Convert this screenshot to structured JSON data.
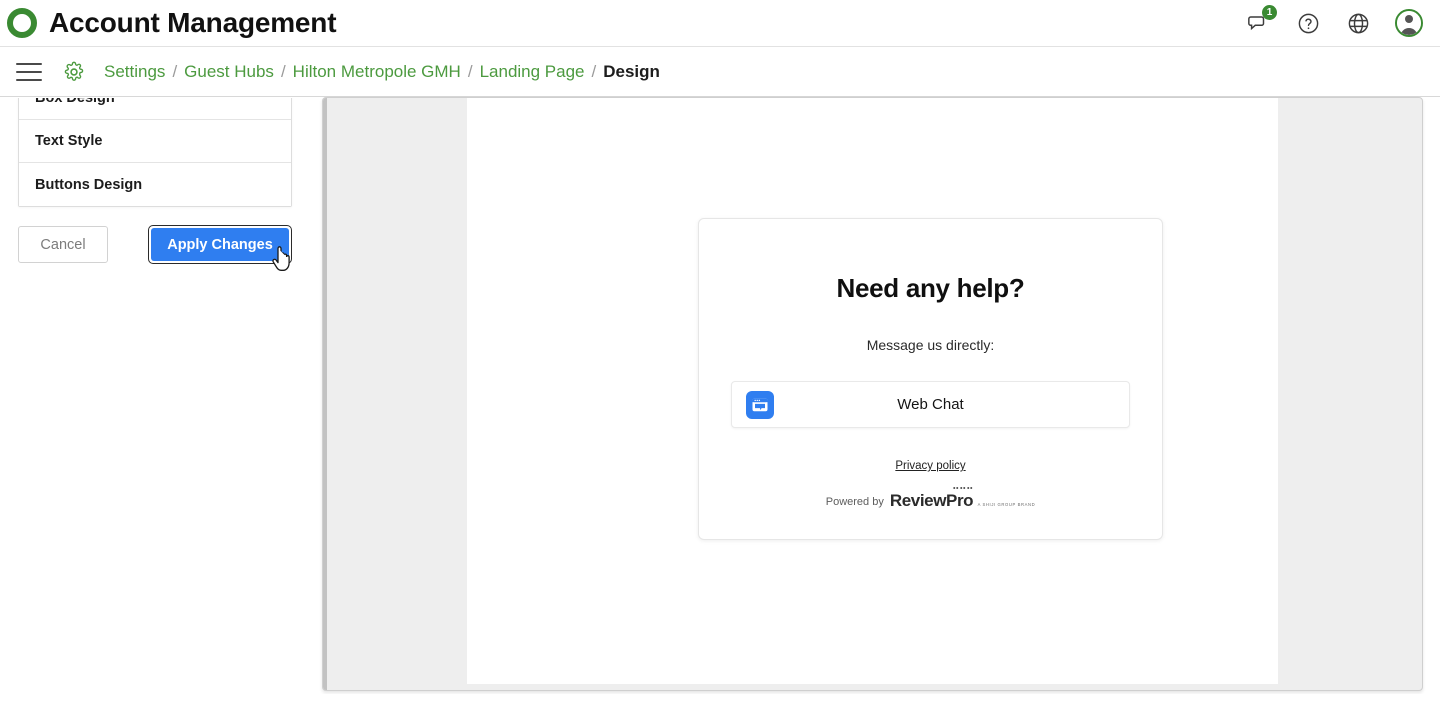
{
  "topbar": {
    "logo_icon": "ring-logo-icon",
    "title": "Account Management",
    "icons": [
      {
        "name": "chat-bubble-icon",
        "badge": "1"
      },
      {
        "name": "help-circle-icon"
      },
      {
        "name": "globe-icon"
      },
      {
        "name": "user-avatar-icon"
      }
    ]
  },
  "breadcrumb_bar": {
    "menu_icon": "hamburger-menu-icon",
    "settings_icon": "gear-icon",
    "separator": "/",
    "crumbs": [
      {
        "label": "Settings",
        "current": false
      },
      {
        "label": "Guest Hubs",
        "current": false
      },
      {
        "label": "Hilton Metropole GMH",
        "current": false
      },
      {
        "label": "Landing Page",
        "current": false
      },
      {
        "label": "Design",
        "current": true
      }
    ]
  },
  "sidebar": {
    "sections": [
      {
        "label": "Box Design"
      },
      {
        "label": "Text Style"
      },
      {
        "label": "Buttons Design"
      }
    ],
    "cancel_label": "Cancel",
    "apply_label": "Apply Changes",
    "cursor_icon": "pointer-hand-cursor-icon"
  },
  "preview": {
    "card": {
      "title": "Need any help?",
      "subtitle": "Message us directly:",
      "channels": [
        {
          "label": "Web Chat",
          "icon": "web-chat-window-icon",
          "icon_color": "#2f7ef0"
        }
      ],
      "privacy_link": "Privacy policy",
      "powered_by_prefix": "Powered by",
      "powered_by_brand": "ReviewPro",
      "powered_by_tagline": "A SHIJI GROUP BRAND"
    }
  },
  "colors": {
    "brand_green": "#3a8a32",
    "crumb_green": "#4c9a3f",
    "primary_blue": "#2f7ef0",
    "panel_gray": "#eeeeee"
  }
}
